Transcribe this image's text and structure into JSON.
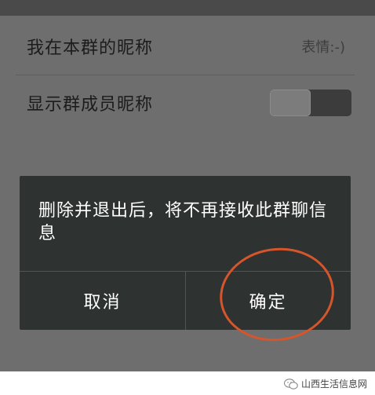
{
  "settings": {
    "group_nickname_label": "我在本群的昵称",
    "group_nickname_value": "表情:-)",
    "show_member_nickname_label": "显示群成员昵称",
    "show_member_nickname_on": false
  },
  "dialog": {
    "message": "删除并退出后，将不再接收此群聊信息",
    "cancel_label": "取消",
    "confirm_label": "确定"
  },
  "annotation": {
    "highlight_color": "#d6552a"
  },
  "watermark": {
    "text": "山西生活信息网",
    "icon": "wechat-icon"
  }
}
